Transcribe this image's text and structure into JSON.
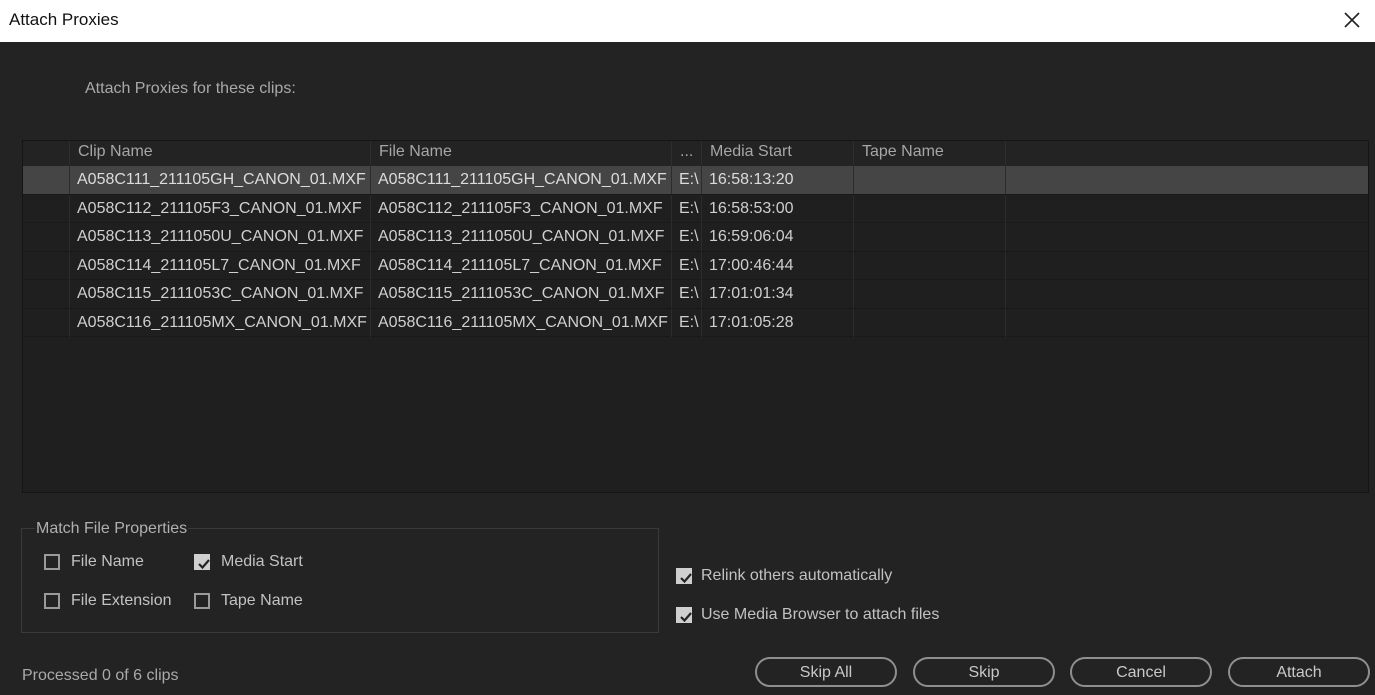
{
  "window": {
    "title": "Attach Proxies"
  },
  "intro_text": "Attach Proxies for these clips:",
  "table": {
    "columns": [
      "",
      "Clip Name",
      "File Name",
      "...",
      "Media Start",
      "Tape Name",
      ""
    ],
    "rows": [
      {
        "clip_name": "A058C111_211105GH_CANON_01.MXF",
        "file_name": "A058C111_211105GH_CANON_01.MXF",
        "path": "E:\\",
        "media_start": "16:58:13:20",
        "tape_name": ""
      },
      {
        "clip_name": "A058C112_211105F3_CANON_01.MXF",
        "file_name": "A058C112_211105F3_CANON_01.MXF",
        "path": "E:\\",
        "media_start": "16:58:53:00",
        "tape_name": ""
      },
      {
        "clip_name": "A058C113_2111050U_CANON_01.MXF",
        "file_name": "A058C113_2111050U_CANON_01.MXF",
        "path": "E:\\",
        "media_start": "16:59:06:04",
        "tape_name": ""
      },
      {
        "clip_name": "A058C114_211105L7_CANON_01.MXF",
        "file_name": "A058C114_211105L7_CANON_01.MXF",
        "path": "E:\\",
        "media_start": "17:00:46:44",
        "tape_name": ""
      },
      {
        "clip_name": "A058C115_2111053C_CANON_01.MXF",
        "file_name": "A058C115_2111053C_CANON_01.MXF",
        "path": "E:\\",
        "media_start": "17:01:01:34",
        "tape_name": ""
      },
      {
        "clip_name": "A058C116_211105MX_CANON_01.MXF",
        "file_name": "A058C116_211105MX_CANON_01.MXF",
        "path": "E:\\",
        "media_start": "17:01:05:28",
        "tape_name": ""
      }
    ],
    "selected_row": 0
  },
  "match": {
    "label": "Match File Properties",
    "file_name": {
      "label": "File Name",
      "checked": false
    },
    "media_start": {
      "label": "Media Start",
      "checked": true
    },
    "file_extension": {
      "label": "File Extension",
      "checked": false
    },
    "tape_name": {
      "label": "Tape Name",
      "checked": false
    }
  },
  "options": {
    "relink": {
      "label": "Relink others automatically",
      "checked": true
    },
    "media_browser": {
      "label": "Use Media Browser to attach files",
      "checked": true
    }
  },
  "status": "Processed 0 of 6 clips",
  "buttons": {
    "skip_all": "Skip All",
    "skip": "Skip",
    "cancel": "Cancel",
    "attach": "Attach"
  },
  "icons": {
    "close": "close-icon",
    "check": "checkmark-icon"
  }
}
